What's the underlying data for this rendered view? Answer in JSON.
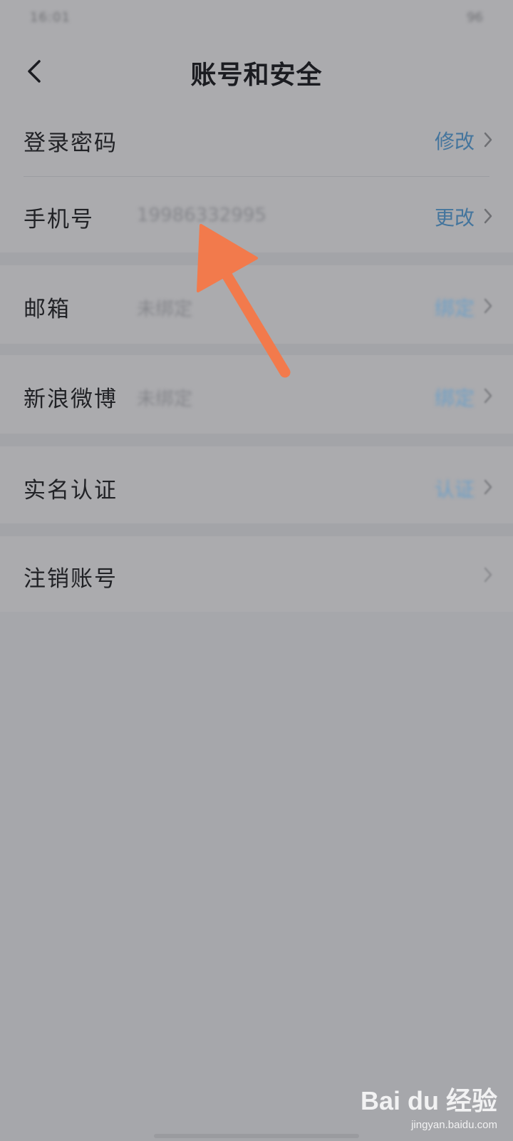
{
  "status_bar": {
    "left_text": "16:01",
    "right_text": "96"
  },
  "header": {
    "back_icon": "chevron-left-icon",
    "title": "账号和安全"
  },
  "rows": [
    {
      "label": "登录密码",
      "value": "",
      "action": "修改"
    },
    {
      "label": "手机号",
      "value": "19986332995",
      "action": "更改"
    },
    {
      "label": "邮箱",
      "value": "未绑定",
      "action": "绑定"
    },
    {
      "label": "新浪微博",
      "value": "未绑定",
      "action": "绑定"
    },
    {
      "label": "实名认证",
      "value": "",
      "action": "认证"
    },
    {
      "label": "注销账号",
      "value": "",
      "action": ""
    }
  ],
  "annotation": {
    "arrow_color": "#f27a4c"
  },
  "watermark": {
    "brand": "Bai du 经验",
    "url": "jingyan.baidu.com"
  },
  "colors": {
    "overlay_bg": "#a6a7ab",
    "action_link": "#44759d"
  }
}
